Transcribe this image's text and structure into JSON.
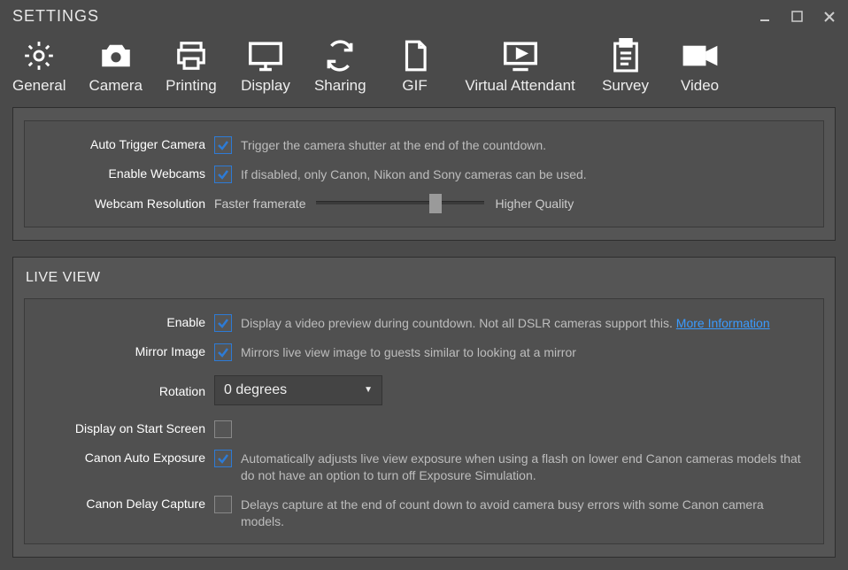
{
  "window": {
    "title": "SETTINGS"
  },
  "tabs": {
    "general": "General",
    "camera": "Camera",
    "printing": "Printing",
    "display": "Display",
    "sharing": "Sharing",
    "gif": "GIF",
    "virtual_attendant": "Virtual Attendant",
    "survey": "Survey",
    "video": "Video"
  },
  "section1": {
    "auto_trigger": {
      "label": "Auto Trigger Camera",
      "checked": true,
      "desc": "Trigger the camera shutter at the end of the countdown."
    },
    "enable_webcams": {
      "label": "Enable Webcams",
      "checked": true,
      "desc": "If disabled, only Canon, Nikon and Sony cameras can be used."
    },
    "resolution": {
      "label": "Webcam Resolution",
      "left": "Faster framerate",
      "right": "Higher Quality"
    }
  },
  "live_view": {
    "title": "LIVE VIEW",
    "enable": {
      "label": "Enable",
      "checked": true,
      "desc": "Display a video preview during countdown. Not all DSLR cameras support this. ",
      "link": "More Information"
    },
    "mirror": {
      "label": "Mirror Image",
      "checked": true,
      "desc": "Mirrors live view image to guests similar to looking at a mirror"
    },
    "rotation": {
      "label": "Rotation",
      "value": "0 degrees"
    },
    "display_start": {
      "label": "Display on Start Screen",
      "checked": false
    },
    "canon_auto": {
      "label": "Canon Auto Exposure",
      "checked": true,
      "desc": "Automatically adjusts live view exposure when using a flash on lower end Canon cameras models that do not have an option to turn off Exposure Simulation."
    },
    "canon_delay": {
      "label": "Canon Delay Capture",
      "checked": false,
      "desc": "Delays capture at the end of count down to avoid camera busy errors with some Canon camera models."
    }
  }
}
